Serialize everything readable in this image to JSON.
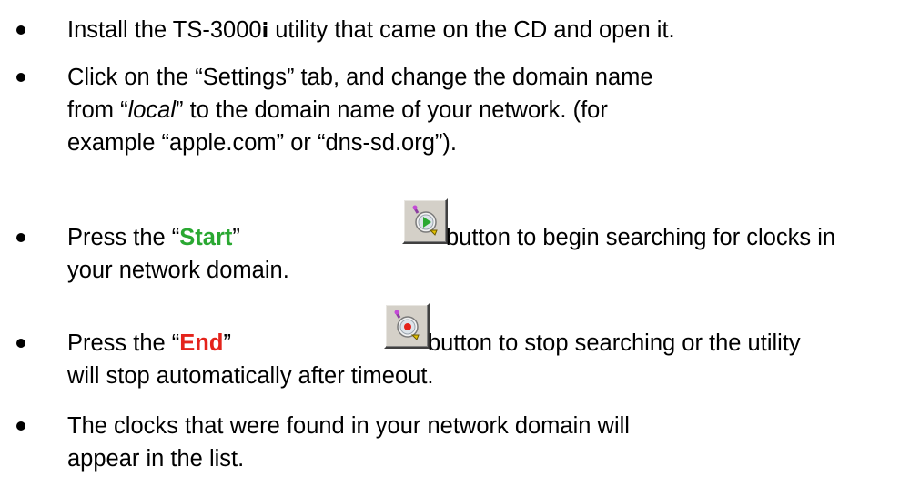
{
  "instructions": {
    "item1": {
      "before": "Install the TS-3000",
      "mark": "i",
      "after": " utility that came on the CD and open it."
    },
    "item2": {
      "line1_a": "Click on the “Settings” tab, and change the domain name",
      "line2_a": "from “",
      "line2_italic": "local",
      "line2_b": "” to the domain name of your network. (for",
      "line3": "example “apple.com” or “dns-sd.org”)."
    },
    "item3": {
      "before": "Press the “",
      "highlight": "Start",
      "after_quote": "”",
      "after_button": " button to begin searching for clocks in",
      "line2": "your network domain.",
      "icon": "start-search-icon",
      "highlight_color": "#2aa832"
    },
    "item4": {
      "before": "Press the “",
      "highlight": "End",
      "after_quote": "”",
      "after_button": " button to stop searching or the utility",
      "line2": "will stop automatically after timeout.",
      "icon": "end-search-icon",
      "highlight_color": "#e4231b"
    },
    "item5": {
      "line1": "The clocks that were found in your network domain will",
      "line2": "appear in the list."
    }
  }
}
